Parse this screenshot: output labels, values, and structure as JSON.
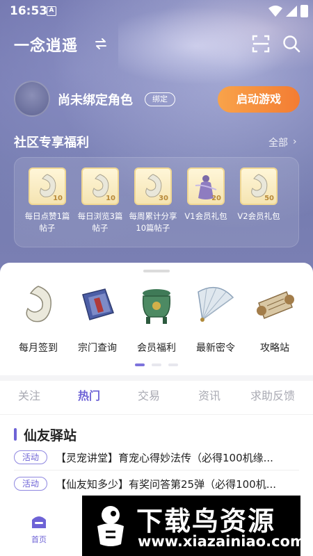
{
  "status_bar": {
    "time": "16:53",
    "sim_label": "A"
  },
  "header": {
    "game_name": "一念逍遥"
  },
  "profile": {
    "character_name": "尚未绑定角色",
    "bind_label": "绑定",
    "start_label": "启动游戏"
  },
  "perks_section": {
    "title": "社区专享福利",
    "see_all": "全部",
    "items": [
      {
        "label": "每日点赞1篇帖子",
        "amount": "10"
      },
      {
        "label": "每日浏览3篇帖子",
        "amount": "10"
      },
      {
        "label": "每周累计分享10篇帖子",
        "amount": "30"
      },
      {
        "label": "V1会员礼包",
        "amount": "20"
      },
      {
        "label": "V2会员礼包",
        "amount": "50"
      }
    ]
  },
  "tools": [
    {
      "label": "每月签到",
      "icon": "jade-hook-icon"
    },
    {
      "label": "宗门查询",
      "icon": "book-icon"
    },
    {
      "label": "会员福利",
      "icon": "cauldron-icon"
    },
    {
      "label": "最新密令",
      "icon": "fan-icon"
    },
    {
      "label": "攻略站",
      "icon": "scroll-icon"
    }
  ],
  "carousel": {
    "pages": 3,
    "active": 0
  },
  "tabs": [
    {
      "label": "关注"
    },
    {
      "label": "热门"
    },
    {
      "label": "交易"
    },
    {
      "label": "资讯"
    },
    {
      "label": "求助反馈"
    }
  ],
  "active_tab": 1,
  "station": {
    "title": "仙友驿站",
    "posts": [
      {
        "tag": "活动",
        "text": "【灵宠讲堂】育宠心得妙法传（必得100机缘..."
      },
      {
        "tag": "活动",
        "text": "【仙友知多少】有奖问答第25弹（必得100机..."
      }
    ]
  },
  "bottom_nav": {
    "home_label": "首页"
  },
  "watermark": {
    "title": "下载鸟资源",
    "url": "www.xiazainiao.com"
  },
  "colors": {
    "accent": "#6e63d6",
    "start_button": "#f58a3a",
    "perk_tile": "#f7e9bd"
  }
}
